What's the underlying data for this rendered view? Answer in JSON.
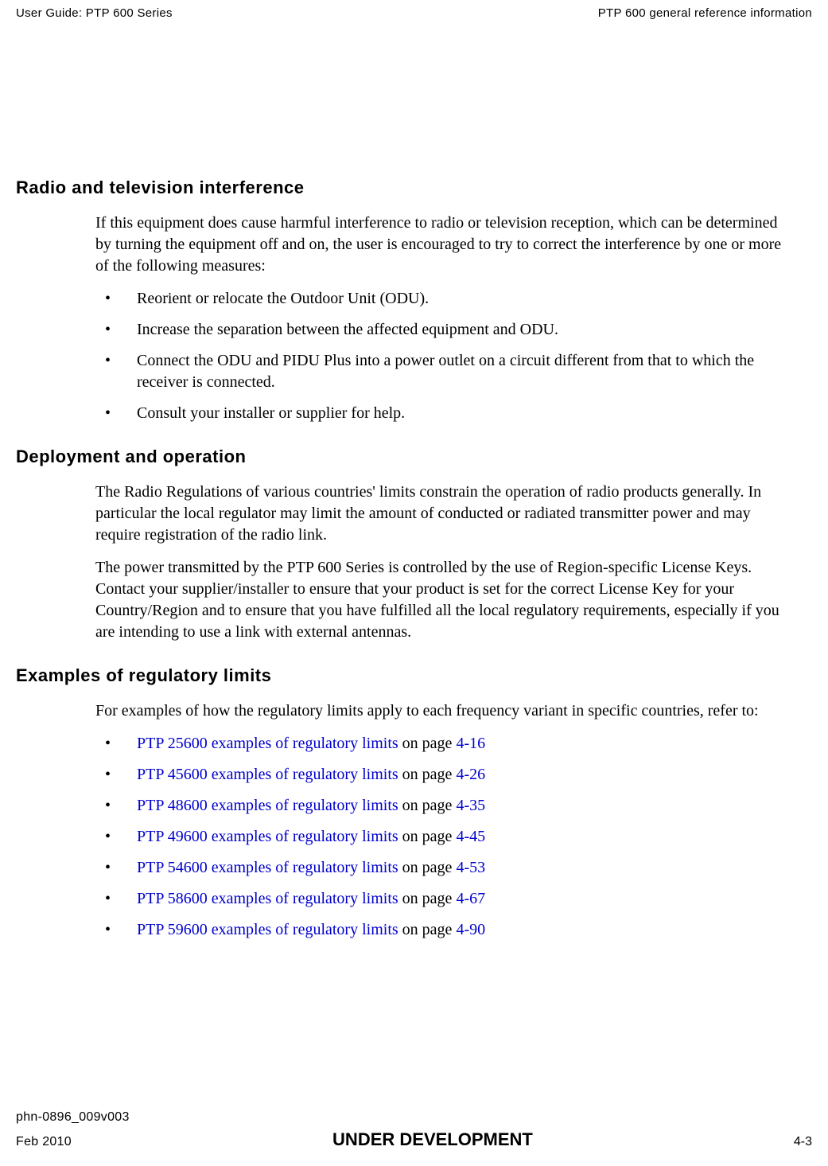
{
  "header": {
    "left": "User Guide: PTP 600 Series",
    "right": "PTP 600 general reference information"
  },
  "sections": {
    "s1": {
      "heading": "Radio and television interference",
      "p1": "If this equipment does cause harmful interference to radio or television reception, which can be determined by turning the equipment off and on, the user is encouraged to try to correct the interference by one or more of the following measures:",
      "b1": "Reorient or relocate the Outdoor Unit (ODU).",
      "b2": "Increase the separation between the affected equipment and ODU.",
      "b3": "Connect the ODU and PIDU Plus into a power outlet on a circuit different from that to which the receiver is connected.",
      "b4": "Consult your installer or supplier for help."
    },
    "s2": {
      "heading": "Deployment and operation",
      "p1": "The Radio Regulations of various countries' limits constrain the operation of radio products generally. In particular the local regulator may limit the amount of conducted or radiated transmitter power and may require registration of the radio link.",
      "p2": "The power transmitted by the PTP 600 Series is controlled by the use of Region-specific License Keys. Contact your supplier/installer to ensure that your product is set for the correct License Key for your Country/Region and to ensure that you have fulfilled all the local regulatory requirements, especially if you are intending to use a link with external antennas."
    },
    "s3": {
      "heading": "Examples of regulatory limits",
      "p1": "For examples of how the regulatory limits apply to each frequency variant in specific countries, refer to:",
      "links": [
        {
          "text": "PTP 25600 examples of regulatory limits",
          "mid": " on page ",
          "page": "4-16"
        },
        {
          "text": "PTP 45600 examples of regulatory limits",
          "mid": " on page ",
          "page": "4-26"
        },
        {
          "text": "PTP 48600 examples of regulatory limits",
          "mid": " on page ",
          "page": "4-35"
        },
        {
          "text": "PTP 49600 examples of regulatory limits",
          "mid": " on page ",
          "page": "4-45"
        },
        {
          "text": "PTP 54600 examples of regulatory limits",
          "mid": " on page ",
          "page": "4-53"
        },
        {
          "text": "PTP 58600 examples of regulatory limits",
          "mid": " on page ",
          "page": "4-67"
        },
        {
          "text": "PTP 59600 examples of regulatory limits",
          "mid": " on page ",
          "page": "4-90"
        }
      ]
    }
  },
  "footer": {
    "docid": "phn-0896_009v003",
    "date": "Feb 2010",
    "status": "UNDER DEVELOPMENT",
    "page": "4-3"
  }
}
